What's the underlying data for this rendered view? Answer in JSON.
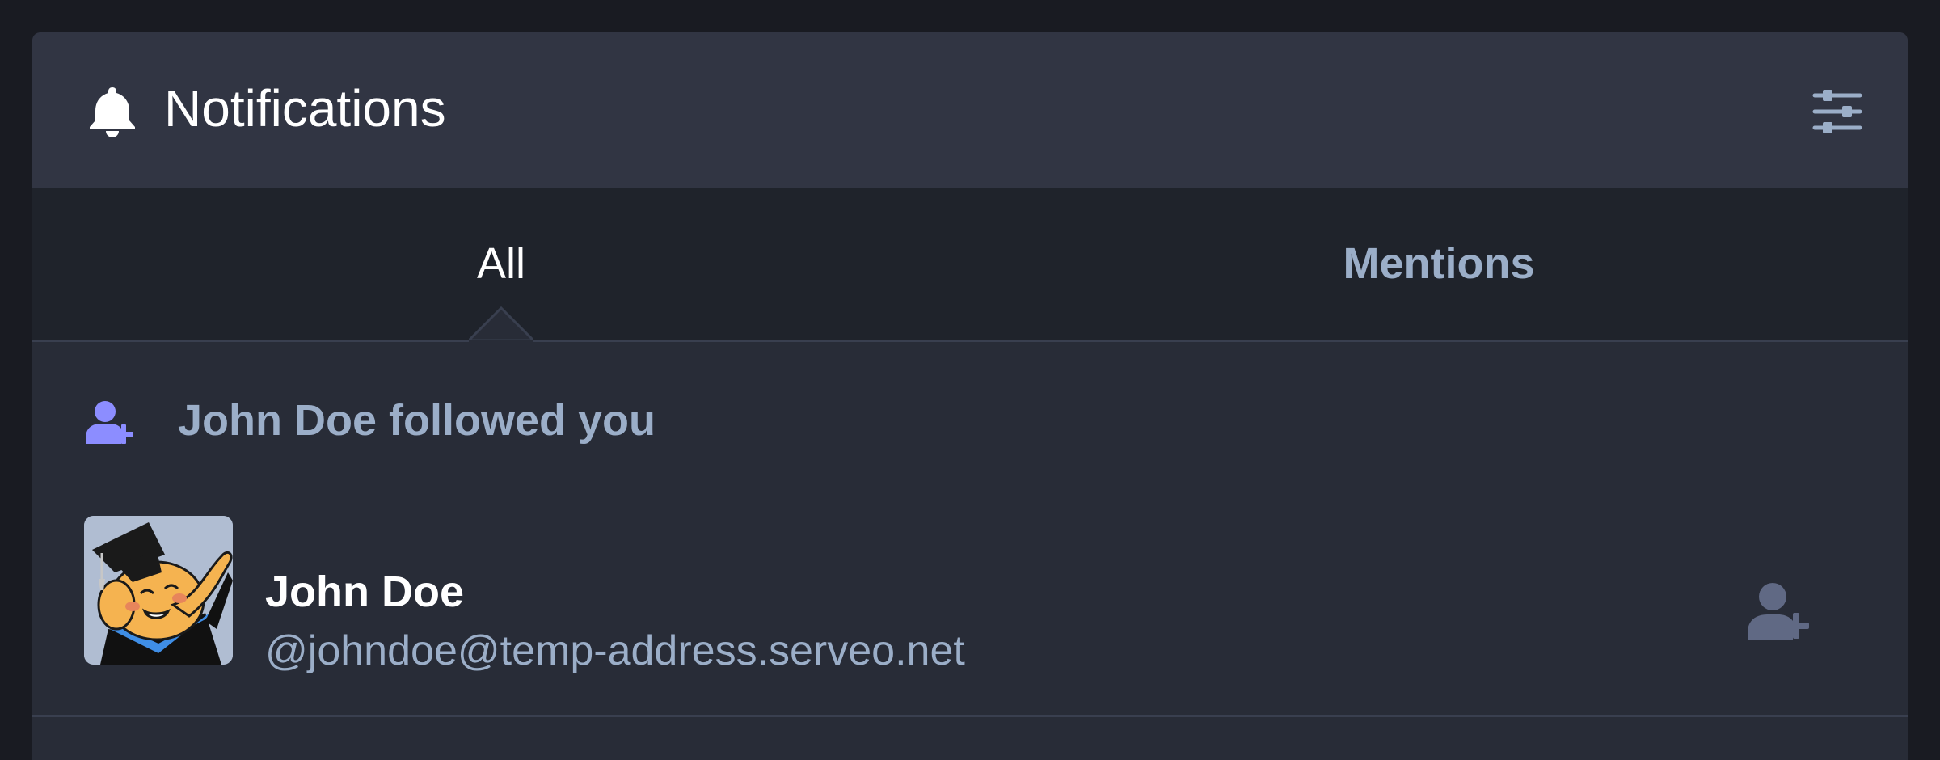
{
  "header": {
    "title": "Notifications",
    "icon": "bell-icon",
    "settings_icon": "sliders-icon"
  },
  "tabs": [
    {
      "label": "All",
      "active": true
    },
    {
      "label": "Mentions",
      "active": false
    }
  ],
  "notification": {
    "icon": "user-plus-icon",
    "text": "John Doe followed you",
    "account": {
      "display_name": "John Doe",
      "acct": "@johndoe@temp-address.serveo.net",
      "avatar": "elephant-graduate-avatar"
    },
    "follow_icon": "user-plus-icon"
  },
  "colors": {
    "accent": "#8c8dff",
    "secondary_text": "#9baec8",
    "header_bg": "#313543",
    "body_bg": "#282c37"
  }
}
